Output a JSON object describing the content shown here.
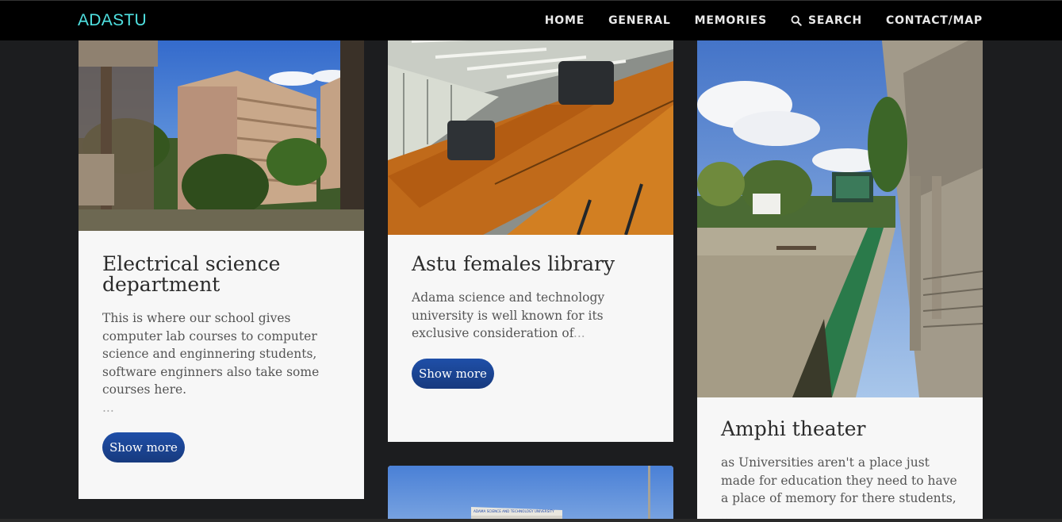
{
  "brand": "ADASTU",
  "nav": [
    {
      "label": "HOME",
      "icon": null
    },
    {
      "label": "GENERAL",
      "icon": null
    },
    {
      "label": "MEMORIES",
      "icon": null
    },
    {
      "label": "SEARCH",
      "icon": "search-icon"
    },
    {
      "label": "CONTACT/MAP",
      "icon": null
    }
  ],
  "cards": [
    {
      "title": "Electrical science department",
      "text": "This is where our school gives computer lab courses to computer science and enginnering students, software enginners also take some courses here.",
      "ellipsis": "...",
      "button": "Show more"
    },
    {
      "title": "Astu females library",
      "text": "Adama science and technology university is well known for its exclusive consideration of",
      "ellipsis": "...",
      "button": "Show more"
    },
    {
      "title": "Amphi theater",
      "text": "as Universities aren't a place just made for education they need to have a place of memory for there students,",
      "ellipsis": "..."
    },
    {
      "sign_text": "ADAMA SCIENCE AND TECHNOLOGY UNIVERSITY"
    }
  ],
  "colors": {
    "brand": "#4fe1e1",
    "navbar_bg": "#000000",
    "page_bg": "#1c1d1f",
    "button_bg": "#1f4fa8"
  }
}
